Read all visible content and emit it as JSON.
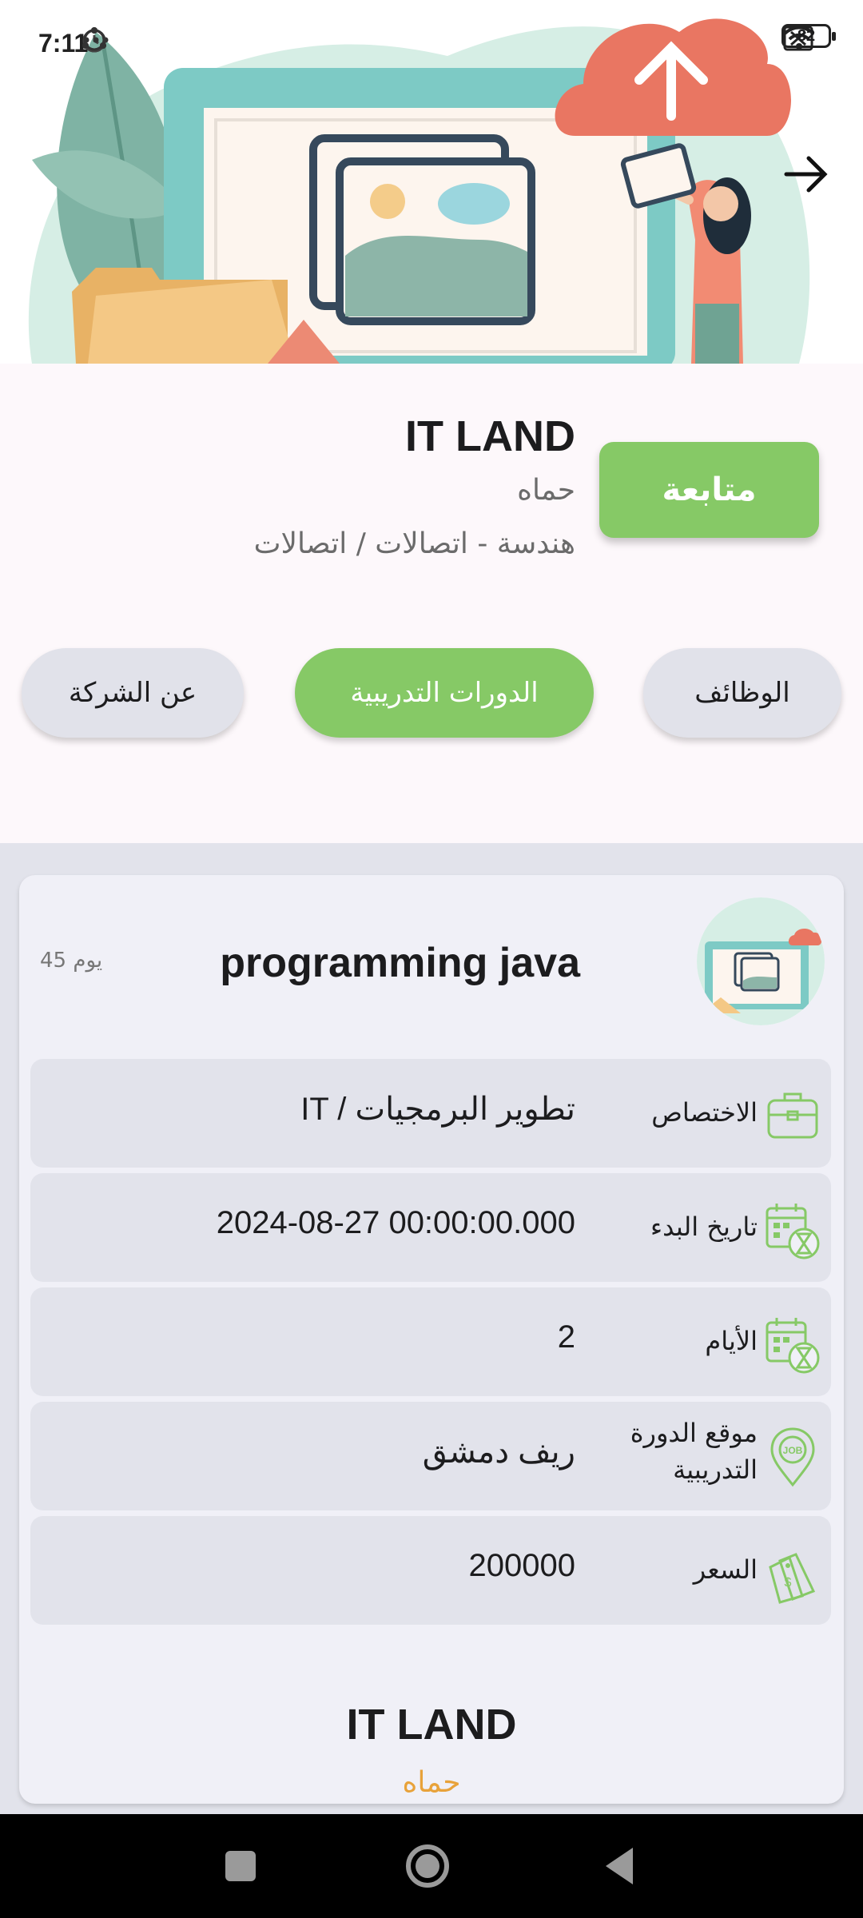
{
  "status_bar": {
    "time": "7:11",
    "battery": "82",
    "icons": [
      "alarm-icon",
      "alarm-icon",
      "sync-icon",
      "sync-icon",
      "more-icon",
      "no-sim-icon",
      "wifi-icon",
      "battery-icon"
    ]
  },
  "header": {
    "back_icon": "arrow-right-icon"
  },
  "company": {
    "name": "IT LAND",
    "city": "حماه",
    "sector": "هندسة - اتصالات / اتصالات",
    "follow_label": "متابعة"
  },
  "tabs": [
    {
      "label": "عن الشركة",
      "active": false
    },
    {
      "label": "الدورات التدريبية",
      "active": true
    },
    {
      "label": "الوظائف",
      "active": false
    }
  ],
  "course": {
    "title": "programming java",
    "duration": "45 يوم",
    "rows": [
      {
        "label": "الاختصاص",
        "value": "IT / تطوير البرمجيات",
        "icon": "briefcase-icon"
      },
      {
        "label": "تاريخ البدء",
        "value": "2024-08-27 00:00:00.000",
        "icon": "calendar-hourglass-icon"
      },
      {
        "label": "الأيام",
        "value": "2",
        "icon": "calendar-hourglass-icon"
      },
      {
        "label": "موقع الدورة التدريبية",
        "value": "ريف دمشق",
        "icon": "job-location-icon"
      },
      {
        "label": "السعر",
        "value": "200000",
        "icon": "price-tag-icon"
      }
    ],
    "company_name": "IT LAND",
    "company_city": "حماه"
  },
  "colors": {
    "accent_green": "#86c966",
    "city_orange": "#e8a23a",
    "card_background": "#f0f0f7",
    "row_background": "#e2e3eb"
  },
  "nav_bar": {
    "buttons": [
      "recents-button",
      "home-button",
      "back-button"
    ]
  }
}
